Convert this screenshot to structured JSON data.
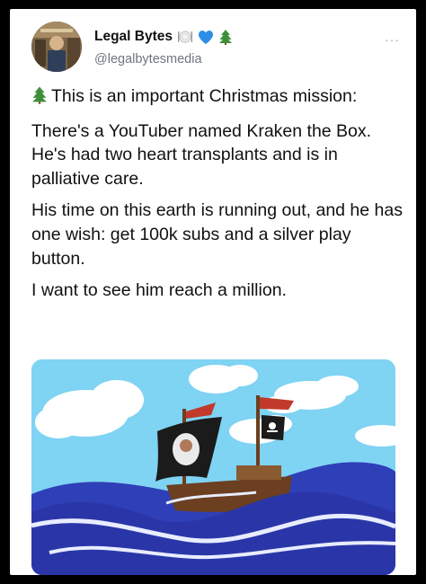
{
  "user": {
    "display_name": "Legal Bytes",
    "handle": "@legalbytesmedia",
    "name_emojis": [
      "plate-cutlery-icon",
      "blue-heart-icon",
      "christmas-tree-icon"
    ]
  },
  "tweet": {
    "paragraphs": [
      "This is an important Christmas mission:",
      "There's a YouTuber named Kraken the Box. He's had two heart transplants and is in palliative care.",
      "His time on this earth is running out, and he has one wish: get 100k subs and a silver play button.",
      "I want to see him reach a million."
    ],
    "lead_emoji": "christmas-tree-icon"
  },
  "media": {
    "description_icon": "pirate-ship-illustration",
    "colors": {
      "sky": "#7fd3f3",
      "sea": "#2a36a8",
      "foam": "#e8ecff",
      "sail": "#1b1b1b",
      "flag": "#c0392b"
    }
  }
}
